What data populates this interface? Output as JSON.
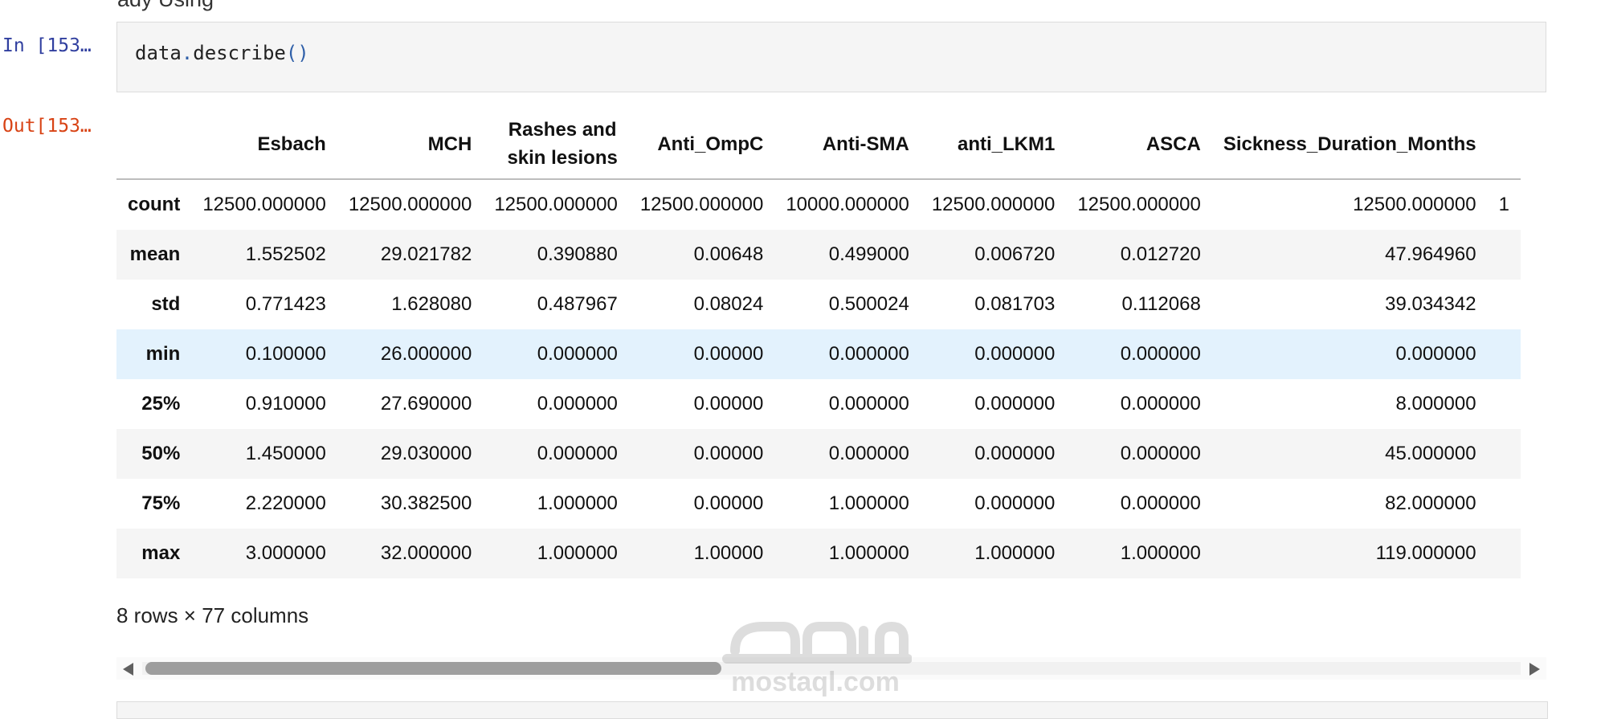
{
  "notebook": {
    "top_fragment": "ady Using",
    "input_prompt": "In [153…",
    "output_prompt": "Out[153…",
    "code": {
      "object": "data",
      "dot": ".",
      "method": "describe",
      "parens": "()"
    }
  },
  "table": {
    "columns": [
      "",
      "Esbach",
      "MCH",
      "Rashes and\nskin lesions",
      "Anti_OmpC",
      "Anti-SMA",
      "anti_LKM1",
      "ASCA",
      "Sickness_Duration_Months"
    ],
    "rows": [
      {
        "stat": "count",
        "values": [
          "12500.000000",
          "12500.000000",
          "12500.000000",
          "12500.000000",
          "10000.000000",
          "12500.000000",
          "12500.000000",
          "12500.000000"
        ],
        "overflow": "1"
      },
      {
        "stat": "mean",
        "values": [
          "1.552502",
          "29.021782",
          "0.390880",
          "0.00648",
          "0.499000",
          "0.006720",
          "0.012720",
          "47.964960"
        ],
        "overflow": ""
      },
      {
        "stat": "std",
        "values": [
          "0.771423",
          "1.628080",
          "0.487967",
          "0.08024",
          "0.500024",
          "0.081703",
          "0.112068",
          "39.034342"
        ],
        "overflow": ""
      },
      {
        "stat": "min",
        "values": [
          "0.100000",
          "26.000000",
          "0.000000",
          "0.00000",
          "0.000000",
          "0.000000",
          "0.000000",
          "0.000000"
        ],
        "overflow": ""
      },
      {
        "stat": "25%",
        "values": [
          "0.910000",
          "27.690000",
          "0.000000",
          "0.00000",
          "0.000000",
          "0.000000",
          "0.000000",
          "8.000000"
        ],
        "overflow": ""
      },
      {
        "stat": "50%",
        "values": [
          "1.450000",
          "29.030000",
          "0.000000",
          "0.00000",
          "0.000000",
          "0.000000",
          "0.000000",
          "45.000000"
        ],
        "overflow": ""
      },
      {
        "stat": "75%",
        "values": [
          "2.220000",
          "30.382500",
          "1.000000",
          "0.00000",
          "1.000000",
          "0.000000",
          "0.000000",
          "82.000000"
        ],
        "overflow": ""
      },
      {
        "stat": "max",
        "values": [
          "3.000000",
          "32.000000",
          "1.000000",
          "1.00000",
          "1.000000",
          "1.000000",
          "1.000000",
          "119.000000"
        ],
        "overflow": ""
      }
    ],
    "highlighted_row": "min",
    "caption": "8 rows × 77 columns"
  },
  "scrollbar": {
    "position": 0.45,
    "left_arrow_icon": "triangle-left-icon",
    "right_arrow_icon": "triangle-right-icon"
  },
  "watermark": {
    "text_arabic": "مستقل",
    "text_latin": "mostaql.com"
  },
  "colors": {
    "input_prompt": "#303f9f",
    "output_prompt": "#d84315",
    "highlight_row": "#e3f2fd",
    "stripe": "#f5f5f5"
  }
}
